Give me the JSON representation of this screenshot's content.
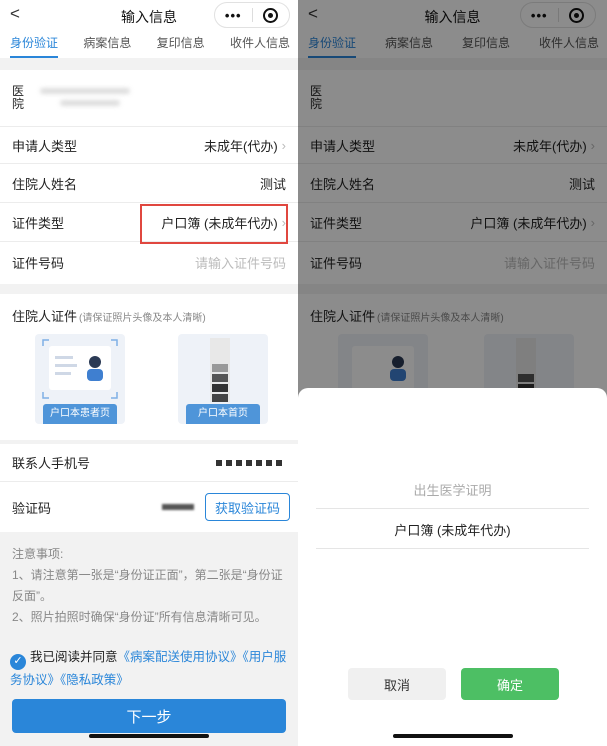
{
  "header": {
    "back": "<",
    "title": "输入信息",
    "capsule_dots": "•••"
  },
  "tabs": [
    "身份验证",
    "病案信息",
    "复印信息",
    "收件人信息"
  ],
  "form": {
    "hospital_label": "医院",
    "applicant_type": {
      "label": "申请人类型",
      "value": "未成年(代办)"
    },
    "patient_name": {
      "label": "住院人姓名",
      "value": "测试"
    },
    "id_type": {
      "label": "证件类型",
      "value": "户口簿 (未成年代办)"
    },
    "id_number": {
      "label": "证件号码",
      "placeholder": "请输入证件号码"
    }
  },
  "documents": {
    "title": "住院人证件",
    "hint": "(请保证照片头像及本人清晰)",
    "cards": [
      {
        "caption": "户口本患者页"
      },
      {
        "caption": "户口本首页"
      }
    ]
  },
  "contact": {
    "phone_label": "联系人手机号",
    "code_label": "验证码",
    "get_code_button": "获取验证码"
  },
  "notice": {
    "title": "注意事项:",
    "line1": "1、请注意第一张是“身份证正面”，第二张是“身份证反面”。",
    "line2": "2、照片拍照时确保“身份证”所有信息清晰可见。"
  },
  "agreement": {
    "prefix": "我已阅读并同意",
    "link1": "《病案配送使用协议》",
    "link2": "《用户服务协议》",
    "link3": "《隐私政策》"
  },
  "next_button": "下一步",
  "picker": {
    "options": [
      "出生医学证明",
      "户口簿 (未成年代办)"
    ],
    "cancel": "取消",
    "confirm": "确定"
  },
  "colors": {
    "accent": "#2a86d9",
    "confirm": "#4dbf64",
    "highlight": "#e0473f"
  }
}
